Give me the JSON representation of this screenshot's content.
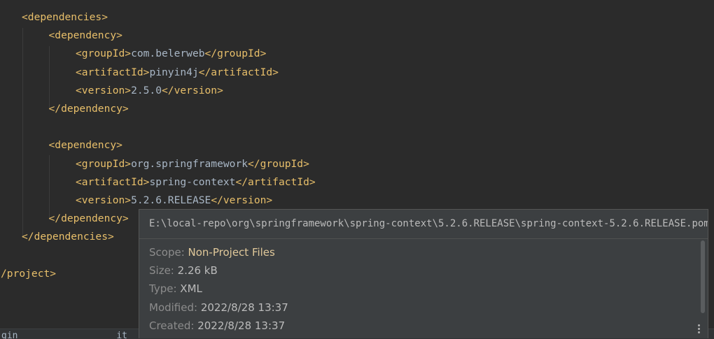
{
  "editor": {
    "lines": [
      {
        "indent": 1,
        "parts": [
          {
            "t": "tag",
            "v": "<dependencies>"
          }
        ]
      },
      {
        "indent": 2,
        "parts": [
          {
            "t": "tag",
            "v": "<dependency>"
          }
        ]
      },
      {
        "indent": 3,
        "parts": [
          {
            "t": "tag",
            "v": "<groupId>"
          },
          {
            "t": "txt",
            "v": "com.belerweb"
          },
          {
            "t": "tag",
            "v": "</groupId>"
          }
        ]
      },
      {
        "indent": 3,
        "parts": [
          {
            "t": "tag",
            "v": "<artifactId>"
          },
          {
            "t": "txt",
            "v": "pinyin4j"
          },
          {
            "t": "tag",
            "v": "</artifactId>"
          }
        ]
      },
      {
        "indent": 3,
        "parts": [
          {
            "t": "tag",
            "v": "<version>"
          },
          {
            "t": "txt",
            "v": "2.5.0"
          },
          {
            "t": "tag",
            "v": "</version>"
          }
        ]
      },
      {
        "indent": 2,
        "parts": [
          {
            "t": "tag",
            "v": "</dependency>"
          }
        ]
      },
      {
        "indent": 0,
        "parts": []
      },
      {
        "indent": 2,
        "parts": [
          {
            "t": "tag",
            "v": "<dependency>"
          }
        ]
      },
      {
        "indent": 3,
        "parts": [
          {
            "t": "tag",
            "v": "<groupId>"
          },
          {
            "t": "txt",
            "v": "org.springframework"
          },
          {
            "t": "tag",
            "v": "</groupId>"
          }
        ]
      },
      {
        "indent": 3,
        "parts": [
          {
            "t": "tag",
            "v": "<artifactId>"
          },
          {
            "t": "txt",
            "v": "spring-context"
          },
          {
            "t": "tag",
            "v": "</artifactId>"
          }
        ]
      },
      {
        "indent": 3,
        "parts": [
          {
            "t": "tag",
            "v": "<version>"
          },
          {
            "t": "txt",
            "v": "5.2.6.RELEASE"
          },
          {
            "t": "tag",
            "v": "</version>"
          }
        ]
      },
      {
        "indent": 2,
        "parts": [
          {
            "t": "tag",
            "v": "</dependency>"
          }
        ]
      },
      {
        "indent": 1,
        "parts": [
          {
            "t": "tag",
            "v": "</dependencies>"
          }
        ]
      },
      {
        "indent": 0,
        "parts": []
      },
      {
        "indent": 0,
        "parts": [
          {
            "t": "tag",
            "v": "/project>"
          }
        ]
      }
    ]
  },
  "bottom_strip": {
    "text": "gin                  it    in"
  },
  "popup": {
    "path": "E:\\local-repo\\org\\springframework\\spring-context\\5.2.6.RELEASE\\spring-context-5.2.6.RELEASE.pom",
    "scope": {
      "label": "Scope:",
      "value": "Non-Project Files"
    },
    "size": {
      "label": "Size:",
      "value": "2.26 kB"
    },
    "type": {
      "label": "Type:",
      "value": "XML"
    },
    "modified": {
      "label": "Modified:",
      "value": "2022/8/28 13:37"
    },
    "created": {
      "label": "Created:",
      "value": "2022/8/28 13:37"
    },
    "more_icon": "vertical-ellipsis-icon"
  },
  "colors": {
    "background": "#2b2b2b",
    "tag": "#e8bf6a",
    "text": "#a9b7c6",
    "popup_bg": "#3c3f41"
  }
}
